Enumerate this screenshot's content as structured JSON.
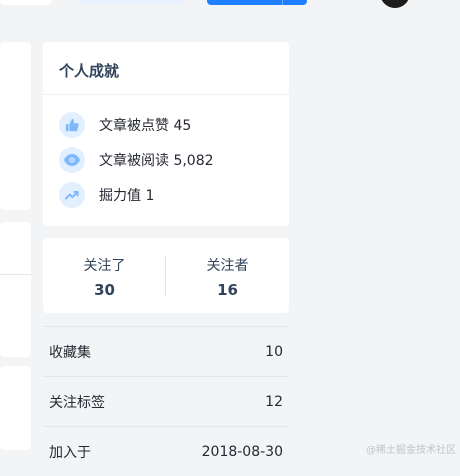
{
  "achievements": {
    "title": "个人成就",
    "items": [
      {
        "icon": "thumbs-up-icon",
        "text": "文章被点赞 45"
      },
      {
        "icon": "eye-icon",
        "text": "文章被阅读 5,082"
      },
      {
        "icon": "trending-up-icon",
        "text": "掘力值 1"
      }
    ]
  },
  "follow": {
    "following_label": "关注了",
    "following_count": "30",
    "followers_label": "关注者",
    "followers_count": "16"
  },
  "stats": [
    {
      "label": "收藏集",
      "value": "10"
    },
    {
      "label": "关注标签",
      "value": "12"
    },
    {
      "label": "加入于",
      "value": "2018-08-30"
    }
  ],
  "watermark": "@稀土掘金技术社区",
  "colors": {
    "accent": "#1e80ff",
    "icon_bg": "#e1efff",
    "icon_fg": "#7fb8ff"
  }
}
